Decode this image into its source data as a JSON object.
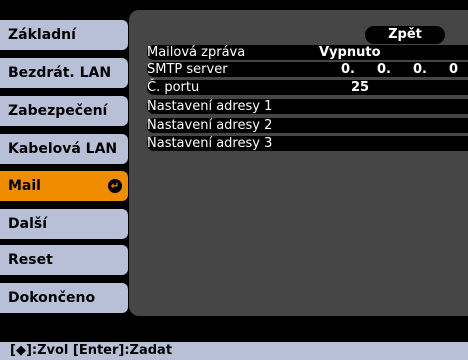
{
  "menu": {
    "items": [
      {
        "label": "Základní"
      },
      {
        "label": "Bezdrát. LAN"
      },
      {
        "label": "Zabezpečení"
      },
      {
        "label": "Kabelová LAN"
      },
      {
        "label": "Mail"
      },
      {
        "label": "Další"
      },
      {
        "label": "Reset"
      },
      {
        "label": "Dokončeno"
      }
    ],
    "active_index": 4,
    "enter_glyph": "↵"
  },
  "panel": {
    "back_label": "Zpět",
    "rows": [
      {
        "label": "Mailová zpráva",
        "value": "Vypnuto"
      },
      {
        "label": "SMTP server",
        "ip": [
          "0.",
          "0.",
          "0.",
          "0"
        ]
      },
      {
        "label": "Č. portu",
        "value": "25"
      },
      {
        "label": "Nastavení adresy 1"
      },
      {
        "label": "Nastavení adresy 2"
      },
      {
        "label": "Nastavení adresy 3"
      }
    ]
  },
  "footer": {
    "hint": "[◆]:Zvol  [Enter]:Zadat"
  },
  "colors": {
    "menu_bg": "#b8c0d8",
    "active": "#f08c00",
    "panel": "#464646",
    "background": "#000000"
  }
}
